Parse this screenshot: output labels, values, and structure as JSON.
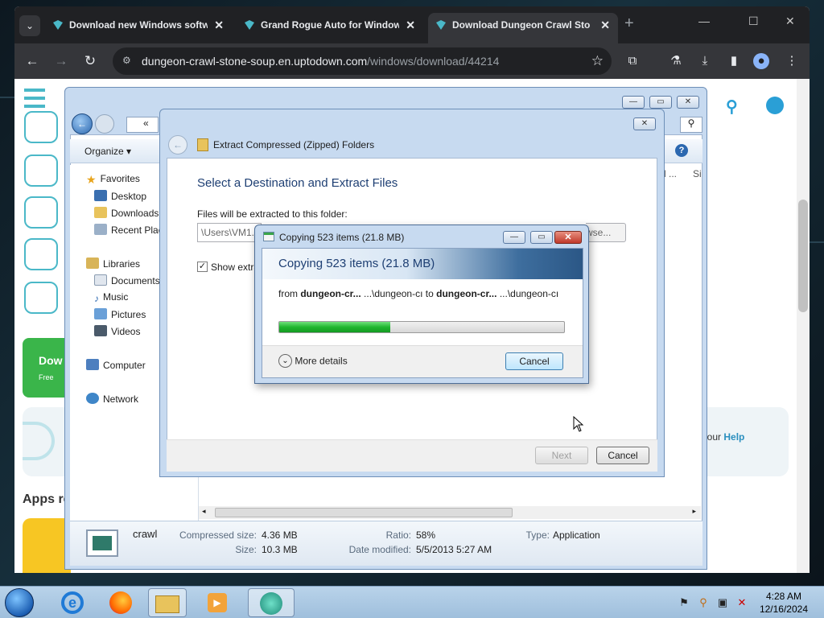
{
  "browser": {
    "tabs": [
      {
        "title": "Download new Windows softw",
        "active": false
      },
      {
        "title": "Grand Rogue Auto for Window",
        "active": false
      },
      {
        "title": "Download Dungeon Crawl Ston",
        "active": true
      }
    ],
    "url_host": "dungeon-crawl-stone-soup.en.uptodown.com",
    "url_path": "/windows/download/44214"
  },
  "page": {
    "download_label": "Dow",
    "free_label": "Free",
    "help_prefix": "t our ",
    "help_link": "Help",
    "apps_heading": "Apps re"
  },
  "explorer": {
    "organize_label": "Organize",
    "breadcrumb": "«",
    "col_a": "d ...",
    "col_b": "Si",
    "nav": {
      "favorites": "Favorites",
      "desktop": "Desktop",
      "downloads": "Downloads",
      "recent": "Recent Plac",
      "libraries": "Libraries",
      "documents": "Documents",
      "music": "Music",
      "pictures": "Pictures",
      "videos": "Videos",
      "computer": "Computer",
      "network": "Network"
    },
    "details": {
      "name": "crawl",
      "compressed_size_label": "Compressed size:",
      "compressed_size": "4.36 MB",
      "size_label": "Size:",
      "size": "10.3 MB",
      "ratio_label": "Ratio:",
      "ratio": "58%",
      "date_label": "Date modified:",
      "date": "5/5/2013 5:27 AM",
      "type_label": "Type:",
      "type": "Application"
    }
  },
  "wizard": {
    "title": "Extract Compressed (Zipped) Folders",
    "heading": "Select a Destination and Extract Files",
    "folder_label": "Files will be extracted to this folder:",
    "folder_value": "\\Users\\VM1.C",
    "browse_label": "wse...",
    "show_label": "Show extra",
    "next_label": "Next",
    "cancel_label": "Cancel"
  },
  "copy": {
    "window_title": "Copying 523 items (21.8 MB)",
    "heading": "Copying 523 items (21.8 MB)",
    "from_word": "from",
    "source": "dungeon-cr...",
    "source_path": "...\\dungeon-cı",
    "to_word": "to",
    "dest": "dungeon-cr...",
    "dest_path": "...\\dungeon-cı",
    "progress": 0.39,
    "more_details": "More details",
    "cancel_label": "Cancel"
  },
  "taskbar": {
    "time": "4:28 AM",
    "date": "12/16/2024"
  },
  "colors": {
    "accent": "#4ab8c8",
    "progress": "#1fb62f",
    "heading_blue": "#1e3f73"
  }
}
